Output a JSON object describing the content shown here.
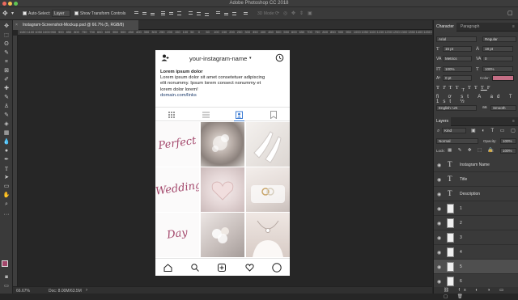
{
  "window": {
    "title": "Adobe Photoshop CC 2018"
  },
  "options_bar": {
    "auto_select_label": "Auto-Select:",
    "auto_select_value": "Layer",
    "show_transform_label": "Show Transform Controls",
    "mode_3d_label": "3D Mode:"
  },
  "document_tab": {
    "close": "×",
    "title": "Instagram-Screenshot-Mockup.psd @ 66.7% (5, RGB/8)"
  },
  "ruler_ticks": [
    "1150",
    "1100",
    "1050",
    "1000",
    "950",
    "900",
    "850",
    "800",
    "750",
    "700",
    "650",
    "600",
    "550",
    "500",
    "450",
    "400",
    "350",
    "300",
    "250",
    "200",
    "150",
    "100",
    "50",
    "0",
    "50",
    "100",
    "150",
    "200",
    "250",
    "300",
    "350",
    "400",
    "450",
    "500",
    "550",
    "600",
    "650",
    "700",
    "750",
    "800",
    "850",
    "900",
    "950",
    "1000",
    "1050",
    "1100",
    "1150",
    "1200",
    "1250",
    "1300",
    "1350",
    "1400",
    "1450",
    "1500"
  ],
  "status_bar": {
    "zoom": "66.67%",
    "doc": "Doc: 8.00M/63.5M"
  },
  "mockup": {
    "username": "your-instagram-name",
    "bio_name": "Lorem ipsum dolor",
    "bio_line1": "Lorem ipsum dolor sit amet consetetuer adipiscing",
    "bio_line2": "elit nonummy. Ipsum lorem consect nonummy et",
    "bio_line3": "lorem dolor lorem!",
    "bio_link": "domain.com/links",
    "script_words": [
      "Perfect",
      "Wedding",
      "Day"
    ]
  },
  "character_panel": {
    "tabs": [
      "Character",
      "Paragraph"
    ],
    "font_family": "Arial",
    "font_style": "Regular",
    "font_size": "15 pt",
    "leading": "18 pt",
    "kerning": "Metrics",
    "tracking": "0",
    "vertical_scale": "100%",
    "horizontal_scale": "100%",
    "baseline_shift": "0 pt",
    "color_label": "Color:",
    "language": "English: UK",
    "antialias": "Smooth",
    "color_swatch": "#c46e85"
  },
  "layers_panel": {
    "tab": "Layers",
    "filter": "Kind",
    "blend_mode": "Normal",
    "opacity_label": "Opacity:",
    "opacity": "100%",
    "lock_label": "Lock:",
    "fill_label": "Fill:",
    "fill": "100%",
    "layers": [
      {
        "name": "Instagram Name",
        "type": "text"
      },
      {
        "name": "Title",
        "type": "text"
      },
      {
        "name": "Description",
        "type": "text"
      },
      {
        "name": "1",
        "type": "image"
      },
      {
        "name": "2",
        "type": "image"
      },
      {
        "name": "3",
        "type": "image"
      },
      {
        "name": "4",
        "type": "image"
      },
      {
        "name": "5",
        "type": "image",
        "selected": true
      },
      {
        "name": "6",
        "type": "image"
      }
    ]
  },
  "colors": {
    "foreground": "#a3476b",
    "background": "#ffffff",
    "accent_script": "#a3476b"
  }
}
